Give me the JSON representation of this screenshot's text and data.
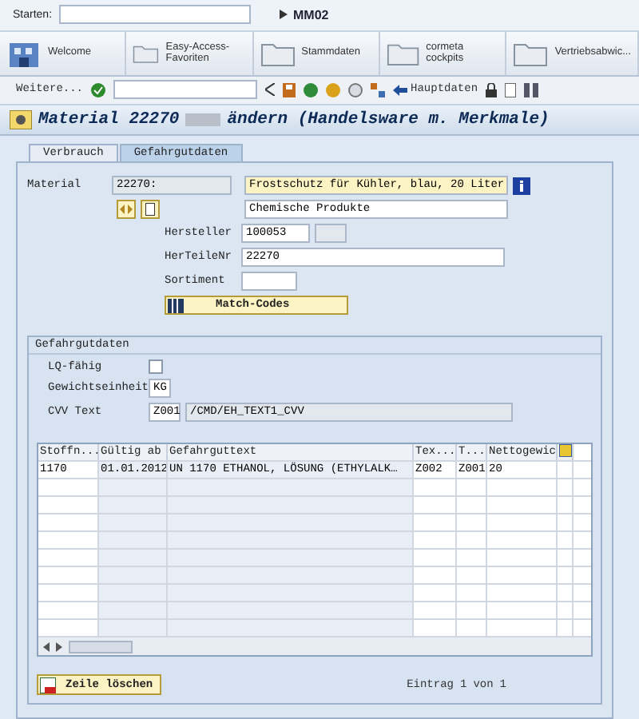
{
  "starter": {
    "label": "Starten:",
    "transaction": "MM02"
  },
  "nav_tabs": [
    {
      "label": "Welcome",
      "kind": "home"
    },
    {
      "label": "Easy-Access-Favoriten",
      "kind": "folder"
    },
    {
      "label": "Stammdaten",
      "kind": "folder"
    },
    {
      "label": "cormeta cockpits",
      "kind": "folder"
    },
    {
      "label": "Vertriebsabwic...",
      "kind": "folder"
    }
  ],
  "toolbar": {
    "more": "Weitere...",
    "hauptdaten": "Hauptdaten"
  },
  "title": {
    "prefix": "Material 22270",
    "suffix": "ändern (Handelsware m. Merkmale)"
  },
  "tabs": [
    {
      "label": "Verbrauch",
      "selected": false
    },
    {
      "label": "Gefahrgutdaten",
      "selected": true
    }
  ],
  "header": {
    "material_label": "Material",
    "material": "22270:",
    "description": "Frostschutz für Kühler, blau, 20 Liter",
    "group": "Chemische Produkte",
    "hersteller_label": "Hersteller",
    "hersteller": "100053",
    "herteilenr_label": "HerTeileNr",
    "herteilenr": "22270",
    "sortiment_label": "Sortiment",
    "matchcodes": "Match-Codes"
  },
  "gefahrgut": {
    "title": "Gefahrgutdaten",
    "lq_label": "LQ-fähig",
    "lq_checked": false,
    "gewicht_label": "Gewichtseinheit",
    "gewicht": "KG",
    "cvv_label": "CVV Text",
    "cvv_code": "Z001",
    "cvv_text": "/CMD/EH_TEXT1_CVV"
  },
  "table": {
    "columns": [
      "Stoffn...",
      "Gültig ab",
      "Gefahrguttext",
      "Tex...",
      "T...",
      "Nettogewic"
    ],
    "rows": [
      [
        "1170",
        "01.01.2012",
        "UN 1170 ETHANOL, LÖSUNG (ETHYLALK…",
        "Z002",
        "Z001",
        "20"
      ]
    ]
  },
  "footer": {
    "delete": "Zeile löschen",
    "entry_label": "Eintrag",
    "entry": "1",
    "of_label": "von",
    "total": "1"
  }
}
